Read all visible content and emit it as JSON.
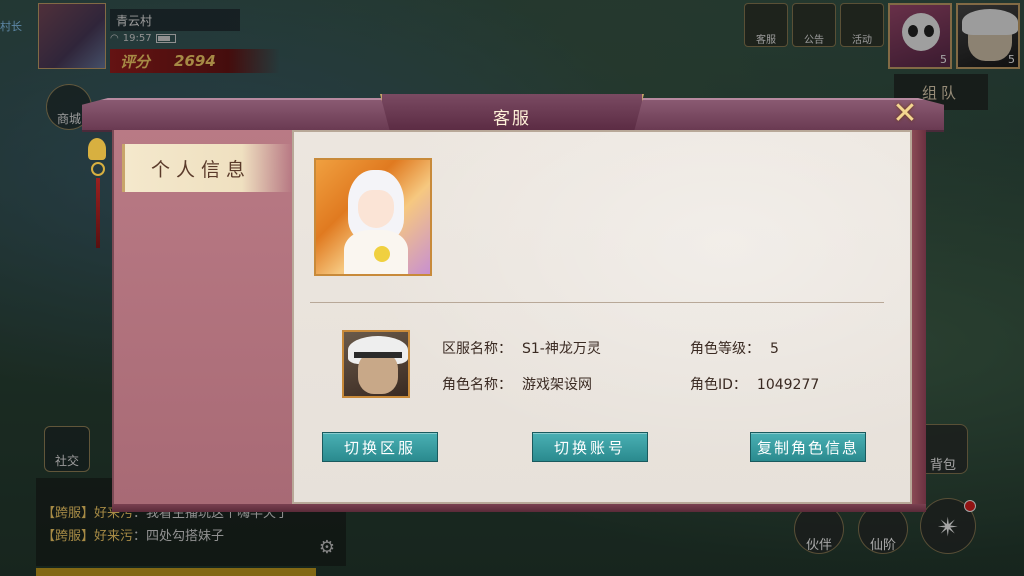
{
  "hud": {
    "location": "青云村",
    "clock": "19:57",
    "score_label": "评分",
    "score_value": "2694",
    "village_chief": "村长",
    "top_icons": [
      {
        "label": "客服",
        "icon": "customer-service-icon"
      },
      {
        "label": "公告",
        "icon": "notice-icon"
      },
      {
        "label": "活动",
        "icon": "gold-coin-icon"
      }
    ],
    "portraits": [
      {
        "name": "panda-pet",
        "level": "5"
      },
      {
        "name": "elder-hero",
        "level": "5"
      }
    ],
    "team_label": "组队",
    "shop_label": "商城",
    "social_label": "社交",
    "bag_label": "背包",
    "partner_label": "伙伴",
    "ascend_label": "仙阶"
  },
  "chat": {
    "lines": [
      {
        "tag": "【跨服】",
        "who": "好来污",
        "text": "：我看主播玩这个嗨半天了"
      },
      {
        "tag": "【跨服】",
        "who": "好来污",
        "text": "：四处勾搭妹子"
      }
    ]
  },
  "dialog": {
    "title": "客服",
    "close_glyph": "✕",
    "tabs": [
      {
        "label": "个人信息",
        "active": true
      }
    ],
    "info": {
      "server_label": "区服名称：",
      "server_value": "S1-神龙万灵",
      "role_level_label": "角色等级：",
      "role_level_value": "5",
      "role_name_label": "角色名称：",
      "role_name_value": "游戏架设网",
      "role_id_label": "角色ID：",
      "role_id_value": "1049277"
    },
    "buttons": {
      "switch_server": "切换区服",
      "switch_account": "切换账号",
      "copy_info": "复制角色信息"
    }
  },
  "colors": {
    "accent_teal": "#2a8a8e",
    "dialog_frame": "#6a3a52",
    "score_gold": "#ffd46a"
  }
}
